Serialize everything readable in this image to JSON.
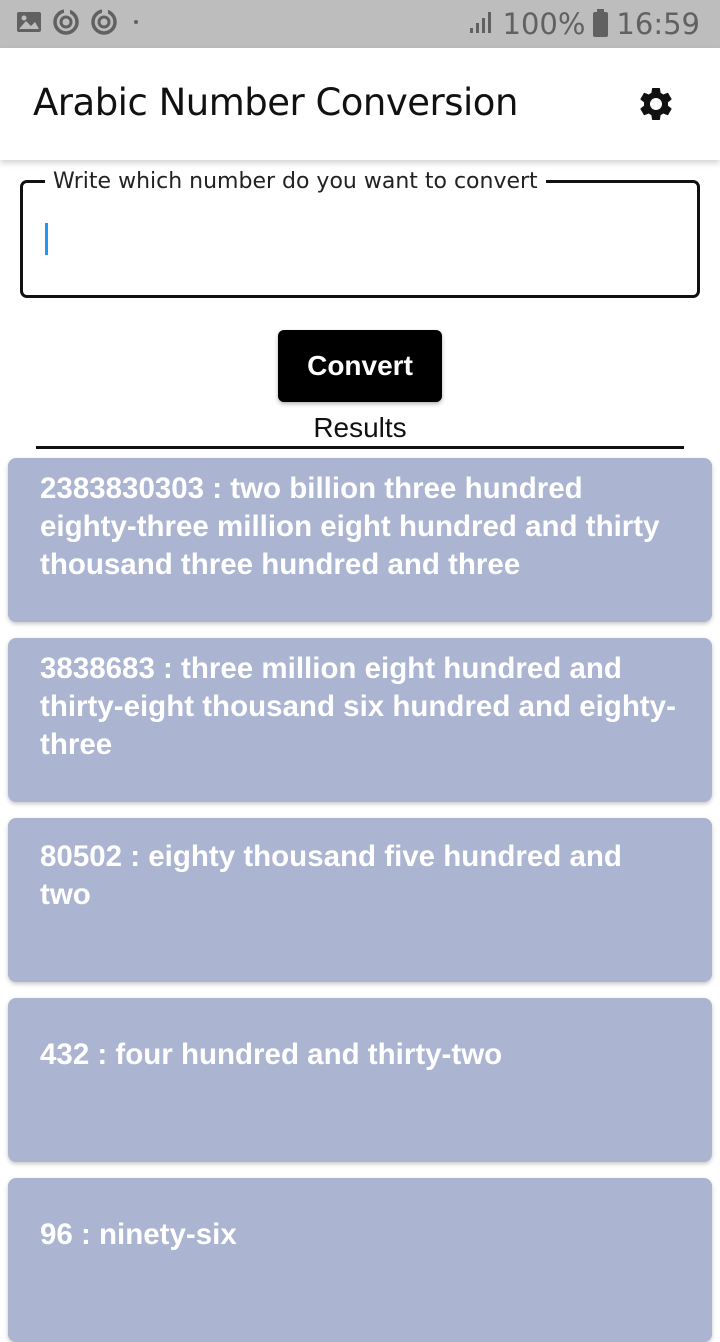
{
  "status_bar": {
    "notification_icons": [
      "image-icon",
      "sync-icon",
      "sync-icon",
      "dot-icon"
    ],
    "signal_icon": "signal-icon",
    "battery_percent": "100%",
    "time": "16:59"
  },
  "app_bar": {
    "title": "Arabic Number Conversion",
    "settings_icon": "gear-icon"
  },
  "input": {
    "label": "Write which number do you want to convert",
    "value": "",
    "placeholder": ""
  },
  "convert_button": {
    "label": "Convert"
  },
  "results": {
    "label": "Results",
    "items": [
      {
        "text": "2383830303 : two billion three hundred eighty-three million eight hundred and thirty thousand three hundred and three"
      },
      {
        "text": "3838683 : three million eight hundred and thirty-eight thousand six hundred and eighty-three"
      },
      {
        "text": "80502 : eighty thousand five hundred and two"
      },
      {
        "text": "432 : four hundred and thirty-two"
      },
      {
        "text": "96 : ninety-six"
      }
    ]
  },
  "colors": {
    "card_background": "#abb4d0",
    "card_text": "#ffffff",
    "button_background": "#000000",
    "caret": "#2196f3",
    "status_bar": "#bdbdbd"
  }
}
